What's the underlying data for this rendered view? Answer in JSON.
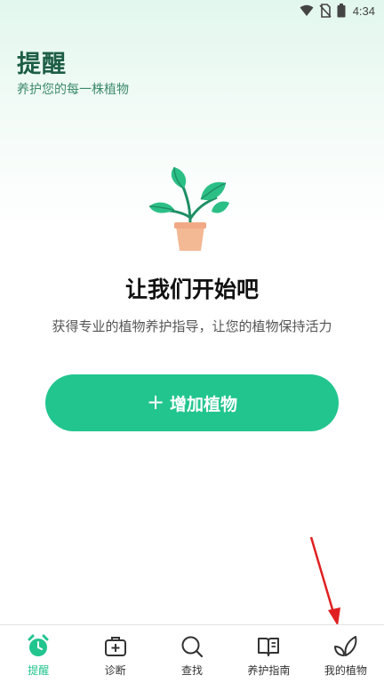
{
  "status_bar": {
    "time": "4:34"
  },
  "header": {
    "title": "提醒",
    "subtitle": "养护您的每一株植物"
  },
  "empty_state": {
    "title": "让我们开始吧",
    "description": "获得专业的植物养护指导，让您的植物保持活力",
    "add_button_icon": "+",
    "add_button_label": "增加植物"
  },
  "bottom_nav": {
    "items": [
      {
        "label": "提醒",
        "icon": "alarm-clock-icon",
        "active": true
      },
      {
        "label": "诊断",
        "icon": "medical-kit-icon",
        "active": false
      },
      {
        "label": "查找",
        "icon": "search-icon",
        "active": false
      },
      {
        "label": "养护指南",
        "icon": "book-icon",
        "active": false
      },
      {
        "label": "我的植物",
        "icon": "leaves-icon",
        "active": false
      }
    ]
  },
  "colors": {
    "accent": "#22c58d",
    "title": "#1d5e45",
    "annotation": "#e02020"
  }
}
